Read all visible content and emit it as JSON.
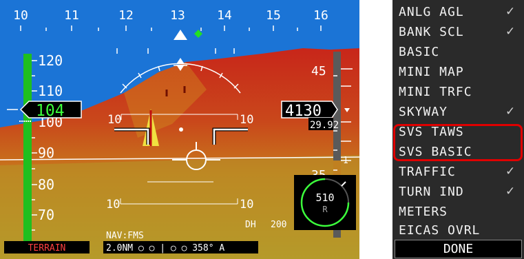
{
  "heading": {
    "scale": [
      "10",
      "11",
      "12",
      "13",
      "14",
      "15",
      "16"
    ]
  },
  "speed_tape": {
    "labels": [
      "120",
      "110",
      "100",
      "90",
      "80",
      "70"
    ],
    "current": "104"
  },
  "alt_tape": {
    "label_45": "45",
    "label_35": "35",
    "label_1": "1",
    "current": "4130",
    "baro": "29.92"
  },
  "pitch": {
    "ten_left": "10",
    "ten_right": "10",
    "ten_left_lower": "10",
    "ten_right_lower": "10"
  },
  "hsi": {
    "value": "510",
    "mode": "R"
  },
  "dh": {
    "label": "DH",
    "value": "200"
  },
  "nav": {
    "source": "NAV:FMS",
    "readout": "2.0NM ○ ○ | ○ ○ 358° A"
  },
  "terrain_label": "TERRAIN",
  "menu": {
    "items": [
      {
        "label": "ANLG AGL",
        "check": "✓"
      },
      {
        "label": "BANK SCL",
        "check": "✓"
      },
      {
        "label": "BASIC",
        "check": ""
      },
      {
        "label": "MINI MAP",
        "check": ""
      },
      {
        "label": "MINI TRFC",
        "check": ""
      },
      {
        "label": "SKYWAY",
        "check": "✓"
      },
      {
        "label": "SVS TAWS",
        "check": ""
      },
      {
        "label": "SVS BASIC",
        "check": ""
      },
      {
        "label": "TRAFFIC",
        "check": "✓"
      },
      {
        "label": "TURN IND",
        "check": "✓"
      },
      {
        "label": "METERS",
        "check": ""
      },
      {
        "label": "EICAS OVRL",
        "check": ""
      }
    ],
    "done": "DONE"
  },
  "colors": {
    "sky": "#1a73d4",
    "terrain_red": "#c02010",
    "terrain_yellow": "#d8c010",
    "tape_green": "#1fbf1f",
    "highlight": "#e00000"
  }
}
